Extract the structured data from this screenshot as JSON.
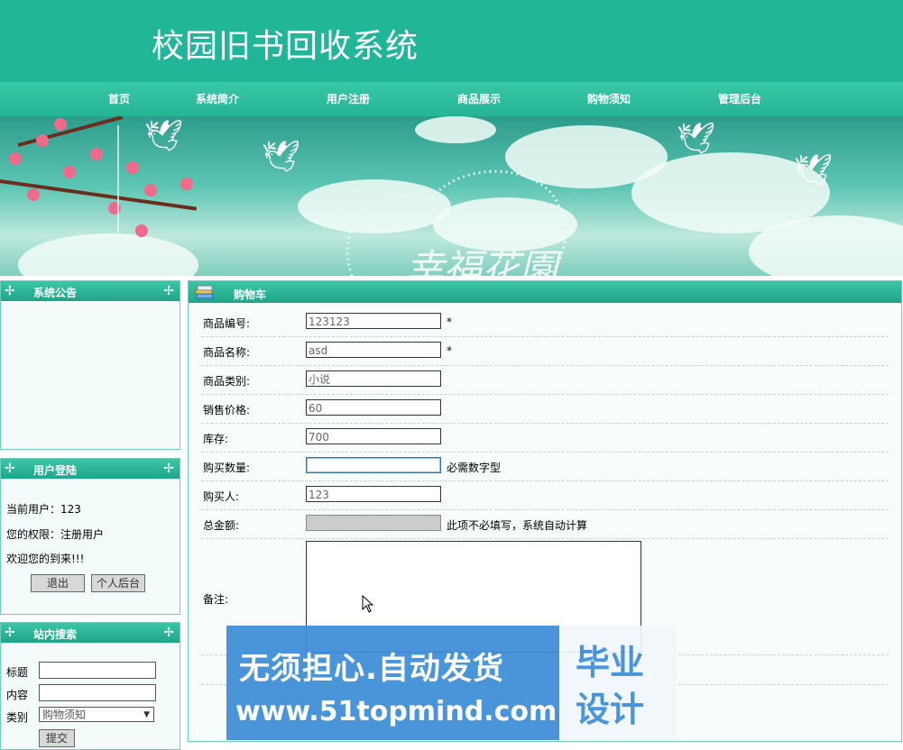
{
  "site": {
    "title": "校园旧书回收系统"
  },
  "nav": [
    {
      "label": "首页"
    },
    {
      "label": "系统简介"
    },
    {
      "label": "用户注册"
    },
    {
      "label": "商品展示"
    },
    {
      "label": "购物须知"
    },
    {
      "label": "管理后台"
    }
  ],
  "banner": {
    "text": "幸福花園"
  },
  "sidebar": {
    "announcement": {
      "title": "系统公告"
    },
    "login": {
      "title": "用户登陆",
      "current_user": "当前用户：123",
      "permission": "您的权限：注册用户",
      "welcome": "欢迎您的到来!!!",
      "logout_button": "退出",
      "personal_button": "个人后台"
    },
    "search": {
      "title": "站内搜索",
      "title_label": "标题",
      "content_label": "内容",
      "category_label": "类别",
      "category_value": "购物须知",
      "submit_button": "提交"
    }
  },
  "cart": {
    "title": "购物车",
    "fields": [
      {
        "label": "商品编号:",
        "value": "123123",
        "hint": "*"
      },
      {
        "label": "商品名称:",
        "value": "asd",
        "hint": "*"
      },
      {
        "label": "商品类别:",
        "value": "小说",
        "hint": ""
      },
      {
        "label": "销售价格:",
        "value": "60",
        "hint": ""
      },
      {
        "label": "库存:",
        "value": "700",
        "hint": ""
      },
      {
        "label": "购买数量:",
        "value": "",
        "hint": "必需数字型"
      },
      {
        "label": "购买人:",
        "value": "123",
        "hint": ""
      },
      {
        "label": "总金额:",
        "value": "",
        "hint": "此项不必填写，系统自动计算"
      }
    ],
    "remark_label": "备注:"
  },
  "watermark": {
    "line1": "无须担心.自动发货",
    "line2": "www.51topmind.com",
    "box_line1": "毕业",
    "box_line2": "设计"
  }
}
